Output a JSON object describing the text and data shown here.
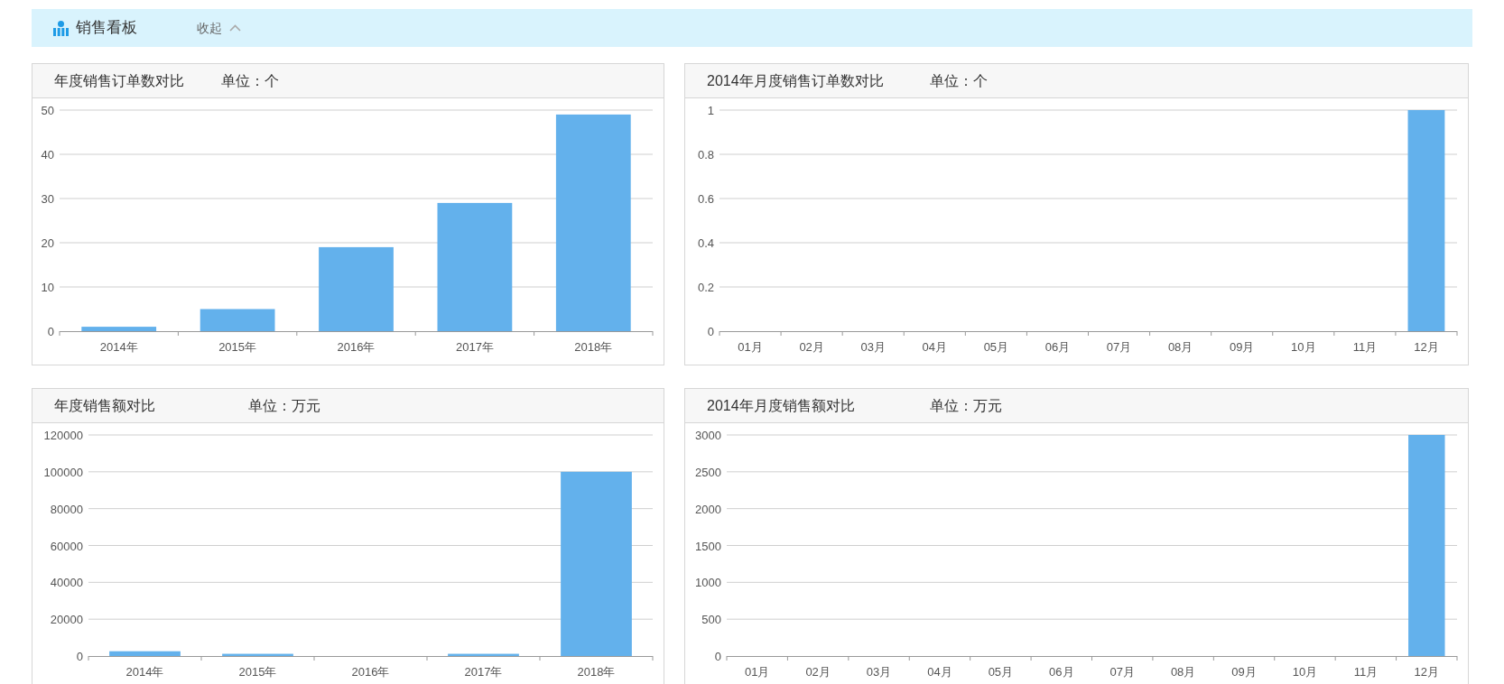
{
  "header": {
    "title": "销售看板",
    "collapse_label": "收起"
  },
  "panels": [
    {
      "title": "年度销售订单数对比",
      "unit": "单位：个",
      "chart_data": {
        "type": "bar",
        "grid": true,
        "categories": [
          "2014年",
          "2015年",
          "2016年",
          "2017年",
          "2018年"
        ],
        "values": [
          1,
          5,
          19,
          29,
          49
        ],
        "ylim": [
          0,
          50
        ],
        "yticks": [
          0,
          10,
          20,
          30,
          40,
          50
        ]
      }
    },
    {
      "title": "2014年月度销售订单数对比",
      "unit": "单位：个",
      "chart_data": {
        "type": "bar",
        "grid": true,
        "categories": [
          "01月",
          "02月",
          "03月",
          "04月",
          "05月",
          "06月",
          "07月",
          "08月",
          "09月",
          "10月",
          "11月",
          "12月"
        ],
        "values": [
          0,
          0,
          0,
          0,
          0,
          0,
          0,
          0,
          0,
          0,
          0,
          1
        ],
        "ylim": [
          0,
          1
        ],
        "yticks": [
          0,
          0.2,
          0.4,
          0.6,
          0.8,
          1
        ]
      }
    },
    {
      "title": "年度销售额对比",
      "unit": "单位：万元",
      "chart_data": {
        "type": "bar",
        "grid": true,
        "categories": [
          "2014年",
          "2015年",
          "2016年",
          "2017年",
          "2018年"
        ],
        "values": [
          2600,
          1200,
          0,
          1200,
          100000
        ],
        "ylim": [
          0,
          120000
        ],
        "yticks": [
          0,
          20000,
          40000,
          60000,
          80000,
          100000,
          120000
        ]
      }
    },
    {
      "title": "2014年月度销售额对比",
      "unit": "单位：万元",
      "chart_data": {
        "type": "bar",
        "grid": true,
        "categories": [
          "01月",
          "02月",
          "03月",
          "04月",
          "05月",
          "06月",
          "07月",
          "08月",
          "09月",
          "10月",
          "11月",
          "12月"
        ],
        "values": [
          0,
          0,
          0,
          0,
          0,
          0,
          0,
          0,
          0,
          0,
          0,
          3000
        ],
        "ylim": [
          0,
          3000
        ],
        "yticks": [
          0,
          500,
          1000,
          1500,
          2000,
          2500,
          3000
        ]
      }
    }
  ]
}
